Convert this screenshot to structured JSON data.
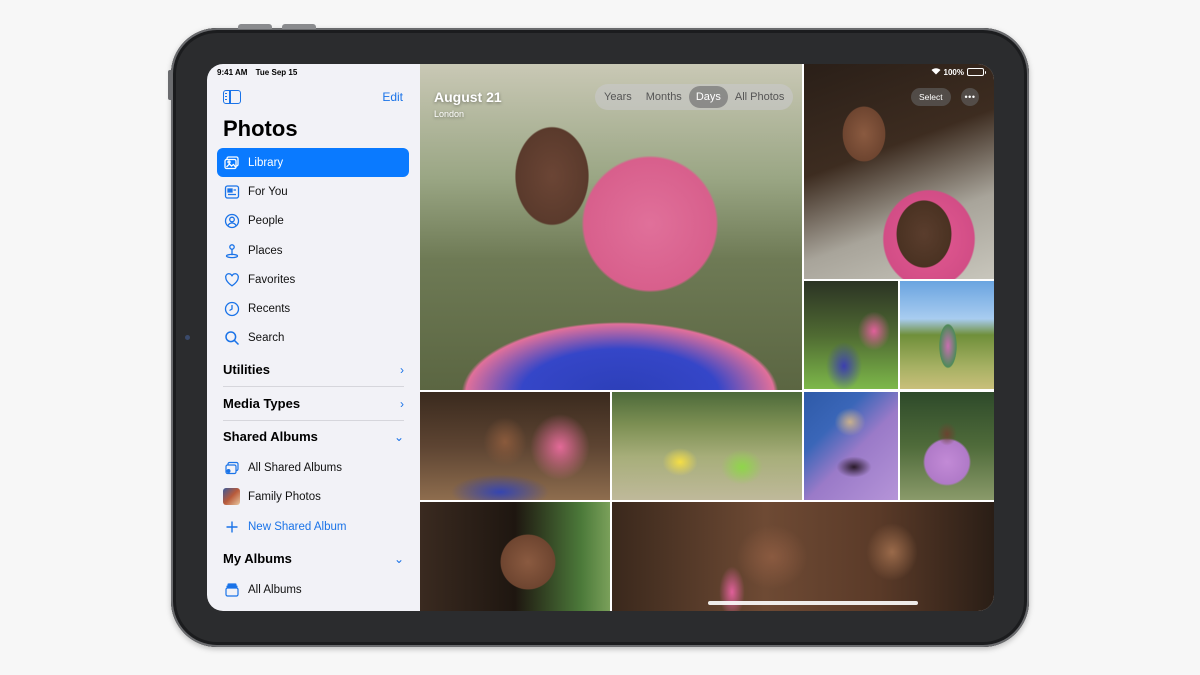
{
  "status": {
    "time": "9:41 AM",
    "date": "Tue Sep 15",
    "battery": "100%"
  },
  "sidebar": {
    "edit_label": "Edit",
    "title": "Photos",
    "items": [
      {
        "label": "Library",
        "icon": "library-icon",
        "active": true
      },
      {
        "label": "For You",
        "icon": "for-you-icon"
      },
      {
        "label": "People",
        "icon": "people-icon"
      },
      {
        "label": "Places",
        "icon": "places-icon"
      },
      {
        "label": "Favorites",
        "icon": "heart-icon"
      },
      {
        "label": "Recents",
        "icon": "clock-icon"
      },
      {
        "label": "Search",
        "icon": "search-icon"
      }
    ],
    "sections": {
      "utilities": "Utilities",
      "media_types": "Media Types",
      "shared_albums": "Shared Albums",
      "my_albums": "My Albums"
    },
    "shared_items": {
      "all_shared": "All Shared Albums",
      "family": "Family Photos",
      "new_shared": "New Shared Album"
    },
    "my_albums_items": {
      "all_albums": "All Albums"
    }
  },
  "main": {
    "date": "August 21",
    "location": "London",
    "segments": [
      "Years",
      "Months",
      "Days",
      "All Photos"
    ],
    "active_segment": "Days",
    "select_label": "Select",
    "more_label": "•••"
  },
  "colors": {
    "accent": "#0a7aff",
    "link": "#1a73e8",
    "sidebar_bg": "#f2f2f7"
  }
}
